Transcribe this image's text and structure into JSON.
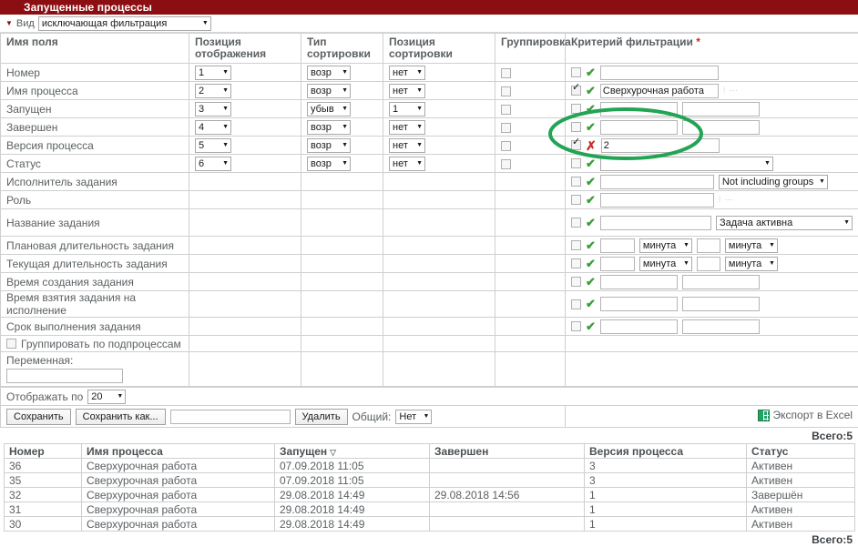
{
  "window": {
    "title": "Запущенные процессы",
    "accent_color": "#8b0e12"
  },
  "view_row": {
    "label": "Вид",
    "selected": "исключающая фильтрация"
  },
  "config_table": {
    "headers": {
      "field_name": "Имя поля",
      "display_position": "Позиция отображения",
      "sort_type": "Тип сортировки",
      "sort_position": "Позиция сортировки",
      "grouping": "Группировка",
      "filter_criteria": "Критерий фильтрации",
      "required_mark": "*"
    },
    "rows": [
      {
        "name": "Номер",
        "display_position": "1",
        "sort_type": "возр",
        "sort_position": "нет",
        "grouping_checked": false,
        "filter": {
          "checked": false,
          "mark": "check",
          "value": "",
          "input_width": 130,
          "second_input": null,
          "unit": null,
          "dropdown": null,
          "dots": false
        }
      },
      {
        "name": "Имя процесса",
        "display_position": "2",
        "sort_type": "возр",
        "sort_position": "нет",
        "grouping_checked": false,
        "filter": {
          "checked": true,
          "mark": "check",
          "value": "Сверхурочная работа",
          "input_width": 130,
          "second_input": null,
          "unit": null,
          "dropdown": null,
          "dots": true
        }
      },
      {
        "name": "Запущен",
        "display_position": "3",
        "sort_type": "убыв",
        "sort_position": "1",
        "grouping_checked": false,
        "filter": {
          "checked": false,
          "mark": "check",
          "value": "",
          "input_width": 85,
          "second_input": "",
          "unit": null,
          "dropdown": null,
          "dots": false
        }
      },
      {
        "name": "Завершен",
        "display_position": "4",
        "sort_type": "возр",
        "sort_position": "нет",
        "grouping_checked": false,
        "filter": {
          "checked": false,
          "mark": "check",
          "value": "",
          "input_width": 85,
          "second_input": "",
          "unit": null,
          "dropdown": null,
          "dots": false
        }
      },
      {
        "name": "Версия процесса",
        "display_position": "5",
        "sort_type": "возр",
        "sort_position": "нет",
        "grouping_checked": false,
        "filter": {
          "checked": true,
          "mark": "cross",
          "value": "2",
          "input_width": 130,
          "second_input": null,
          "unit": null,
          "dropdown": null,
          "dots": false
        }
      },
      {
        "name": "Статус",
        "display_position": "6",
        "sort_type": "возр",
        "sort_position": "нет",
        "grouping_checked": false,
        "filter": {
          "checked": false,
          "mark": "check",
          "value": "",
          "input_width": 0,
          "second_input": null,
          "unit": null,
          "dropdown": "",
          "dropdown_width": 190,
          "dots": false
        }
      },
      {
        "name": "Исполнитель задания",
        "display_position": null,
        "sort_type": null,
        "sort_position": null,
        "grouping_checked": null,
        "filter": {
          "checked": false,
          "mark": "check",
          "value": "",
          "input_width": 125,
          "second_input": null,
          "unit": null,
          "dropdown": "Not including groups",
          "dropdown_width": 120,
          "dots": false
        }
      },
      {
        "name": "Роль",
        "display_position": null,
        "sort_type": null,
        "sort_position": null,
        "grouping_checked": null,
        "filter": {
          "checked": false,
          "mark": "check",
          "value": "",
          "input_width": 125,
          "second_input": null,
          "unit": null,
          "dropdown": null,
          "dots": true
        }
      },
      {
        "name": "Название задания",
        "display_position": null,
        "sort_type": null,
        "sort_position": null,
        "grouping_checked": null,
        "filter": {
          "checked": false,
          "mark": "check",
          "value": "",
          "input_width": 125,
          "second_input": null,
          "unit": null,
          "dropdown": "Задача активна",
          "dropdown_width": 150,
          "dots": false
        }
      },
      {
        "name": "Плановая длительность задания",
        "display_position": null,
        "sort_type": null,
        "sort_position": null,
        "grouping_checked": null,
        "filter": {
          "checked": false,
          "mark": "check",
          "value": "",
          "input_width": 38,
          "second_input": "",
          "second_width": 26,
          "unit": "минута",
          "unit2": "минута",
          "dropdown": null,
          "dots": false
        }
      },
      {
        "name": "Текущая длительность задания",
        "display_position": null,
        "sort_type": null,
        "sort_position": null,
        "grouping_checked": null,
        "filter": {
          "checked": false,
          "mark": "check",
          "value": "",
          "input_width": 38,
          "second_input": "",
          "second_width": 26,
          "unit": "минута",
          "unit2": "минута",
          "dropdown": null,
          "dots": false
        }
      },
      {
        "name": "Время создания задания",
        "display_position": null,
        "sort_type": null,
        "sort_position": null,
        "grouping_checked": null,
        "filter": {
          "checked": false,
          "mark": "check",
          "value": "",
          "input_width": 85,
          "second_input": "",
          "unit": null,
          "dropdown": null,
          "dots": false
        }
      },
      {
        "name": "Время взятия задания на исполнение",
        "display_position": null,
        "sort_type": null,
        "sort_position": null,
        "grouping_checked": null,
        "filter": {
          "checked": false,
          "mark": "check",
          "value": "",
          "input_width": 85,
          "second_input": "",
          "unit": null,
          "dropdown": null,
          "dots": false
        }
      },
      {
        "name": "Срок выполнения задания",
        "display_position": null,
        "sort_type": null,
        "sort_position": null,
        "grouping_checked": null,
        "filter": {
          "checked": false,
          "mark": "check",
          "value": "",
          "input_width": 85,
          "second_input": "",
          "unit": null,
          "dropdown": null,
          "dots": false
        }
      }
    ],
    "group_by_subprocess": {
      "label": "Группировать по подпроцессам",
      "checked": false
    },
    "variable": {
      "label": "Переменная:",
      "value": ""
    }
  },
  "footer": {
    "display_by_label": "Отображать по",
    "display_by_value": "20",
    "save_label": "Сохранить",
    "save_as_label": "Сохранить как...",
    "save_as_value": "",
    "delete_label": "Удалить",
    "shared_label": "Общий:",
    "shared_value": "Нет",
    "export_label": "Экспорт в Excel",
    "export_icon": "excel-icon",
    "total_top": "Всего:5",
    "total_bottom": "Всего:5"
  },
  "results_table": {
    "columns": [
      "Номер",
      "Имя процесса",
      "Запущен",
      "Завершен",
      "Версия процесса",
      "Статус"
    ],
    "sorted_column_index": 2,
    "sort_glyph": "▽",
    "rows": [
      {
        "number": "36",
        "process_name": "Сверхурочная работа",
        "started": "07.09.2018 11:05",
        "finished": "",
        "version": "3",
        "status": "Активен"
      },
      {
        "number": "35",
        "process_name": "Сверхурочная работа",
        "started": "07.09.2018 11:05",
        "finished": "",
        "version": "3",
        "status": "Активен"
      },
      {
        "number": "32",
        "process_name": "Сверхурочная работа",
        "started": "29.08.2018 14:49",
        "finished": "29.08.2018 14:56",
        "version": "1",
        "status": "Завершён"
      },
      {
        "number": "31",
        "process_name": "Сверхурочная работа",
        "started": "29.08.2018 14:49",
        "finished": "",
        "version": "1",
        "status": "Активен"
      },
      {
        "number": "30",
        "process_name": "Сверхурочная работа",
        "started": "29.08.2018 14:49",
        "finished": "",
        "version": "1",
        "status": "Активен"
      }
    ]
  },
  "annotation": {
    "type": "ellipse-highlight",
    "color": "#23a455",
    "target_row": "Версия процесса"
  }
}
